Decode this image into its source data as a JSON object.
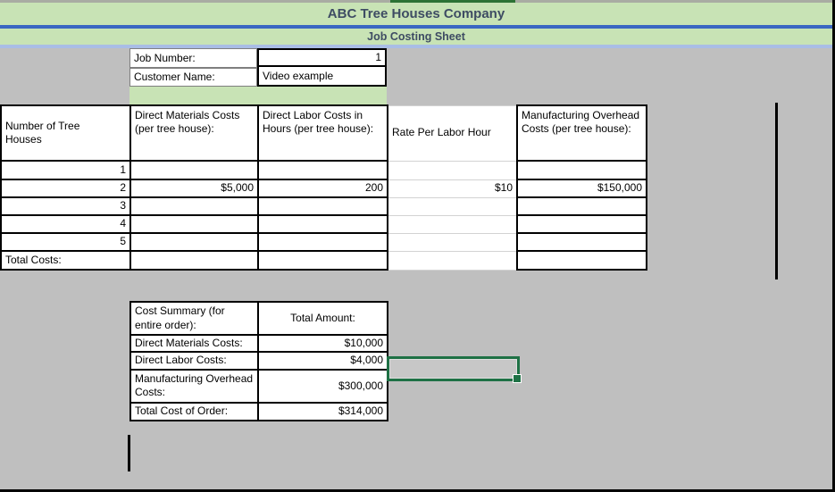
{
  "titles": {
    "company": "ABC Tree Houses Company",
    "sheet": "Job Costing Sheet"
  },
  "job_info": {
    "job_number_label": "Job Number:",
    "job_number_value": "1",
    "customer_name_label": "Customer Name:",
    "customer_name_value": "Video example"
  },
  "main_table": {
    "headers": [
      "Number of Tree Houses",
      "Direct Materials Costs (per tree house):",
      "Direct Labor Costs in Hours (per tree house):",
      "Rate Per Labor Hour",
      "Manufacturing Overhead Costs (per tree house):"
    ],
    "rows": [
      [
        "1",
        "",
        "",
        "",
        ""
      ],
      [
        "2",
        "$5,000",
        "200",
        "$10",
        "$150,000"
      ],
      [
        "3",
        "",
        "",
        "",
        ""
      ],
      [
        "4",
        "",
        "",
        "",
        ""
      ],
      [
        "5",
        "",
        "",
        "",
        ""
      ],
      [
        "Total Costs:",
        "",
        "",
        "",
        ""
      ]
    ]
  },
  "cost_summary": {
    "title": "Cost Summary (for entire order):",
    "amount_header": "Total Amount:",
    "items": [
      {
        "label": "Direct Materials Costs:",
        "value": "$10,000"
      },
      {
        "label": "Direct Labor Costs:",
        "value": "$4,000"
      },
      {
        "label": "Manufacturing Overhead Costs:",
        "value": "$300,000"
      },
      {
        "label": "Total Cost of Order:",
        "value": "$314,000"
      }
    ]
  },
  "colors": {
    "band_green": "#C8E3B5",
    "divider_blue": "#3A67C2",
    "divider_light_blue": "#A9BDE5",
    "accent_dark_green": "#2C7234",
    "selection_green": "#1E7145",
    "background_gray": "#BFBFBF",
    "title_text": "#3E4C63"
  }
}
